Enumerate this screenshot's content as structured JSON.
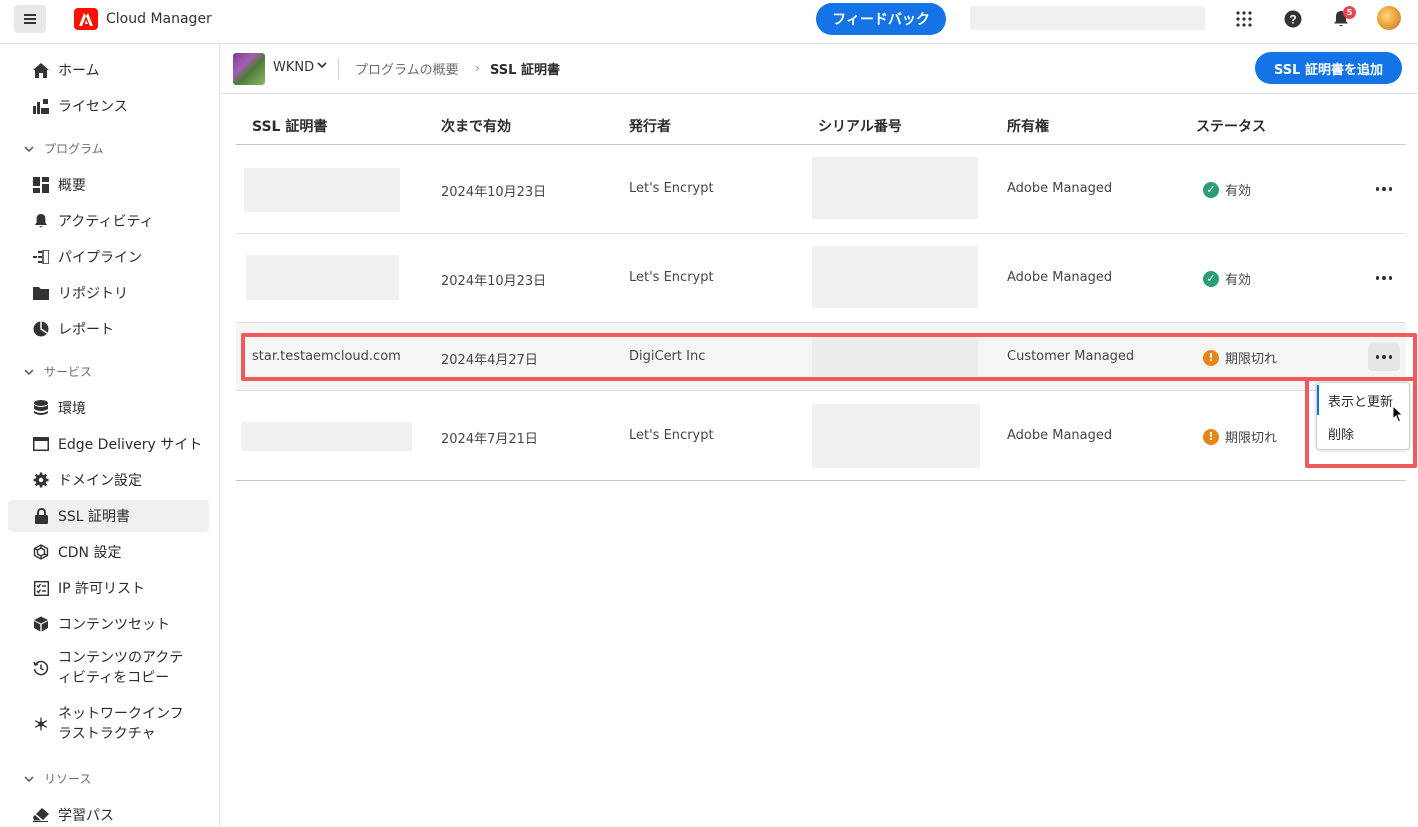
{
  "app": {
    "title": "Cloud Manager",
    "feedback_label": "フィードバック",
    "notification_count": "5"
  },
  "sidebar": {
    "items": [
      {
        "label": "ホーム",
        "icon": "home-icon"
      },
      {
        "label": "ライセンス",
        "icon": "license-icon"
      },
      {
        "label": "概要",
        "icon": "dashboard-icon"
      },
      {
        "label": "アクティビティ",
        "icon": "bell-icon"
      },
      {
        "label": "パイプライン",
        "icon": "pipeline-icon"
      },
      {
        "label": "リポジトリ",
        "icon": "folder-icon"
      },
      {
        "label": "レポート",
        "icon": "pie-chart-icon"
      },
      {
        "label": "環境",
        "icon": "database-icon"
      },
      {
        "label": "Edge Delivery サイト",
        "icon": "browser-window-icon"
      },
      {
        "label": "ドメイン設定",
        "icon": "gear-icon"
      },
      {
        "label": "SSL 証明書",
        "icon": "lock-icon",
        "selected": true
      },
      {
        "label": "CDN 設定",
        "icon": "network-icon"
      },
      {
        "label": "IP 許可リスト",
        "icon": "checklist-icon"
      },
      {
        "label": "コンテンツセット",
        "icon": "box-icon"
      },
      {
        "label": "コンテンツのアクテ\nィビティをコピー",
        "icon": "history-icon"
      },
      {
        "label": "ネットワークインフ\nラストラクチャ",
        "icon": "hub-icon"
      },
      {
        "label": "学習パス",
        "icon": "eraser-icon"
      }
    ],
    "sections": [
      "プログラム",
      "サービス",
      "リソース"
    ]
  },
  "breadcrumb": {
    "program": "WKND",
    "parent": "プログラムの概要",
    "current": "SSL 証明書"
  },
  "add_button_label": "SSL 証明書を追加",
  "table": {
    "headers": [
      "SSL 証明書",
      "次まで有効",
      "発行者",
      "シリアル番号",
      "所有権",
      "ステータス"
    ],
    "rows": [
      {
        "name": "",
        "valid_until": "2024年10月23日",
        "issuer": "Let's Encrypt",
        "serial": "",
        "ownership": "Adobe Managed",
        "status": "有効",
        "status_type": "ok"
      },
      {
        "name": "",
        "valid_until": "2024年10月23日",
        "issuer": "Let's Encrypt",
        "serial": "",
        "ownership": "Adobe Managed",
        "status": "有効",
        "status_type": "ok"
      },
      {
        "name": "star.testaemcloud.com",
        "valid_until": "2024年4月27日",
        "issuer": "DigiCert Inc",
        "serial": "",
        "ownership": "Customer Managed",
        "status": "期限切れ",
        "status_type": "warn"
      },
      {
        "name": "",
        "valid_until": "2024年7月21日",
        "issuer": "Let's Encrypt",
        "serial": "",
        "ownership": "Adobe Managed",
        "status": "期限切れ",
        "status_type": "warn"
      }
    ]
  },
  "menu": {
    "items": [
      "表示と更新",
      "削除"
    ]
  },
  "colors": {
    "accent": "#1473e6",
    "highlight": "#f05a5a",
    "ok": "#2d9d78",
    "warn": "#e68619"
  }
}
